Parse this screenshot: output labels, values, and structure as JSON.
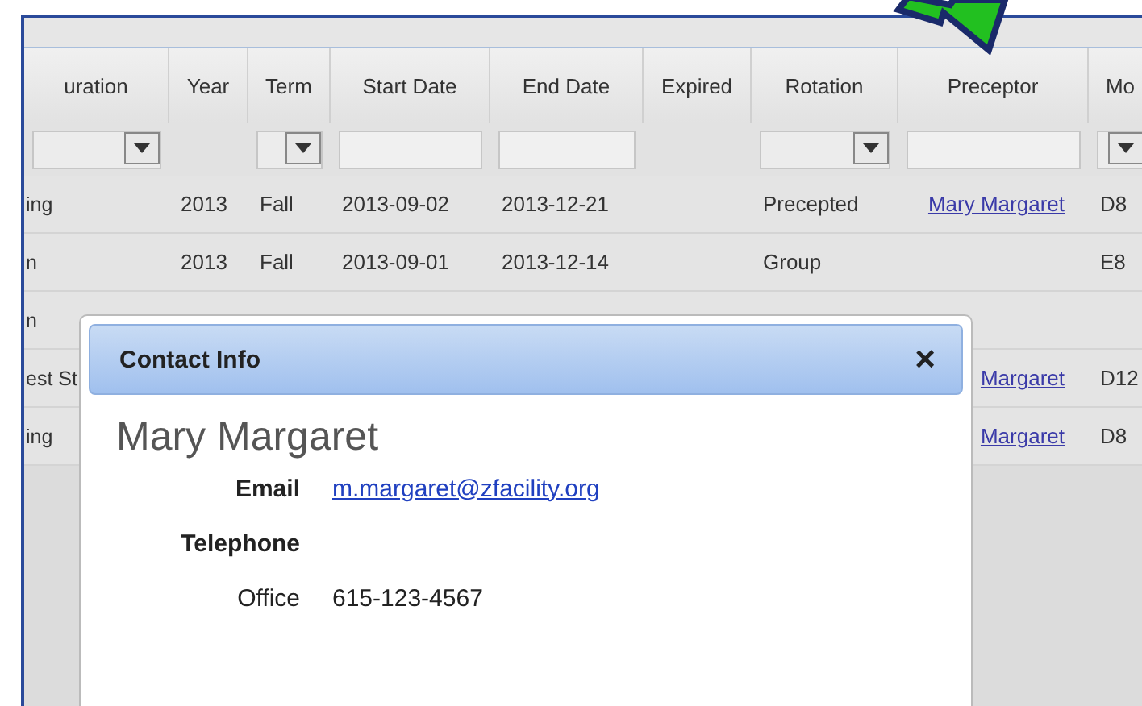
{
  "table": {
    "columns": [
      "uration",
      "Year",
      "Term",
      "Start Date",
      "End Date",
      "Expired",
      "Rotation",
      "Preceptor",
      "Mo"
    ],
    "filters": [
      {
        "kind": "select"
      },
      {
        "kind": "none"
      },
      {
        "kind": "select"
      },
      {
        "kind": "text"
      },
      {
        "kind": "text"
      },
      {
        "kind": "none"
      },
      {
        "kind": "select"
      },
      {
        "kind": "text"
      },
      {
        "kind": "select"
      }
    ],
    "rows": [
      {
        "column_1": "ing",
        "year": "2013",
        "term": "Fall",
        "start_date": "2013-09-02",
        "end_date": "2013-12-21",
        "rotation": "Precepted",
        "preceptor": "Mary Margaret",
        "column_9": "D8"
      },
      {
        "column_1": "n",
        "year": "2013",
        "term": "Fall",
        "start_date": "2013-09-01",
        "end_date": "2013-12-14",
        "rotation": "Group",
        "column_9": "E8"
      },
      {
        "column_1": "n"
      },
      {
        "column_1": "est St",
        "preceptor": "Margaret",
        "column_9": "D12"
      },
      {
        "column_1": "ing",
        "preceptor": "Margaret",
        "column_9": "D8"
      }
    ]
  },
  "dialog": {
    "title": "Contact Info",
    "close": "×",
    "name": "Mary Margaret",
    "fields": [
      {
        "kind": "heading",
        "label": "Email",
        "value": "m.margaret@zfacility.org"
      },
      {
        "kind": "heading",
        "label": "Telephone"
      },
      {
        "kind": "plain",
        "label": "Office",
        "value": "615-123-4567"
      }
    ]
  }
}
